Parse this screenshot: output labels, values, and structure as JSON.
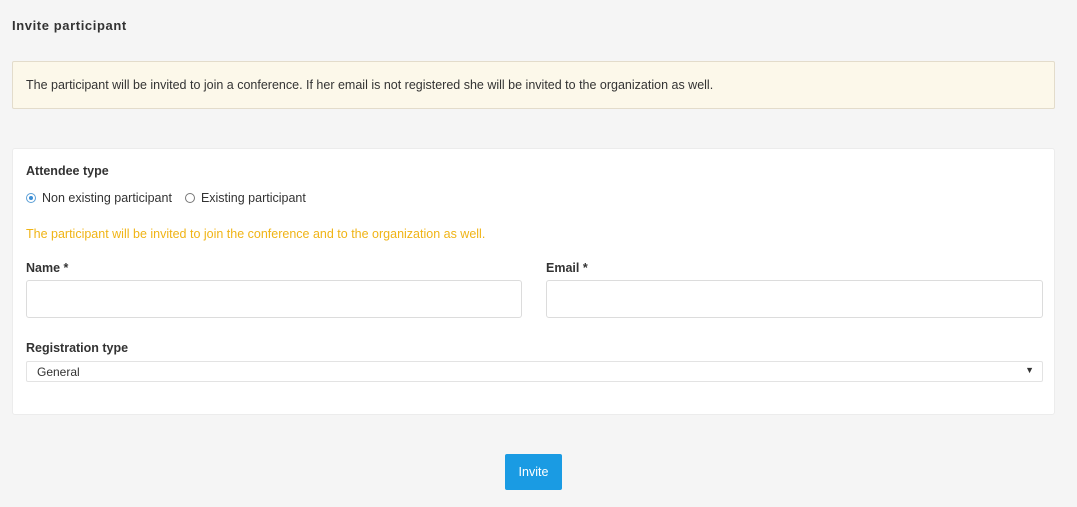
{
  "page": {
    "title": "Invite participant"
  },
  "notice": {
    "text": "The participant will be invited to join a conference. If her email is not registered she will be invited to the organization as well."
  },
  "form": {
    "attendee_type_label": "Attendee type",
    "options": [
      {
        "label": "Non existing participant",
        "selected": true
      },
      {
        "label": "Existing participant",
        "selected": false
      }
    ],
    "hint": "The participant will be invited to join the conference and to the organization as well.",
    "name_label": "Name *",
    "name_value": "",
    "email_label": "Email *",
    "email_value": "",
    "registration_type_label": "Registration type",
    "registration_type_value": "General",
    "caret": "▼"
  },
  "actions": {
    "invite_label": "Invite"
  },
  "colors": {
    "accent": "#1a9be3",
    "hint": "#f0b416",
    "notice_bg": "#fcf8ea"
  }
}
